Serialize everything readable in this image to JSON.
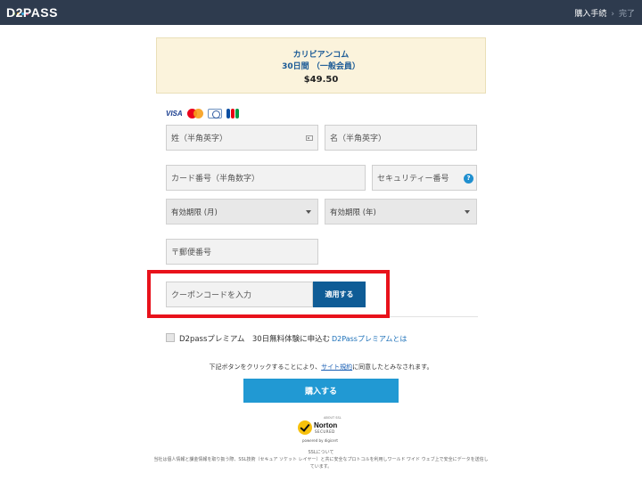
{
  "header": {
    "logo": "D2PASS",
    "steps": [
      {
        "label": "購入手続"
      },
      {
        "label": "完了"
      }
    ],
    "separator": "›"
  },
  "product": {
    "name": "カリビアンコム",
    "plan": "30日間 （一般会員）",
    "price": "$49.50"
  },
  "card_brands": [
    "VISA",
    "mastercard-icon",
    "diners-icon",
    "jcb-icon"
  ],
  "form": {
    "last_name_placeholder": "姓（半角英字）",
    "first_name_placeholder": "名（半角英字）",
    "card_number_placeholder": "カード番号（半角数字）",
    "security_code_placeholder": "セキュリティー番号",
    "help_label": "?",
    "expiry_month": "有効期限 (月)",
    "expiry_year": "有効期限 (年)",
    "postal_placeholder": "〒郵便番号",
    "coupon_placeholder": "クーポンコードを入力",
    "apply_label": "適用する"
  },
  "premium": {
    "text": "D2passプレミアム　30日無料体験に申込む",
    "link": "D2Passプレミアムとは"
  },
  "agreement": {
    "before": "下記ボタンをクリックすることにより、",
    "link": "サイト規約",
    "after": "に同意したとみなされます。"
  },
  "buy_label": "購入する",
  "norton": {
    "top": "ABOUT SSL",
    "word": "Norton",
    "secured": "SECURED",
    "powered": "powered by digicert"
  },
  "ssl": {
    "title": "SSLについて",
    "text": "当社は個人情報と課金情報を取り扱う際、SSL技術（セキュア ソケット レイヤー）と共に安全なプロトコルを利用しワールド ワイド ウェブ上で安全にデータを送信しています。"
  },
  "colors": {
    "header_bg": "#2e3b4e",
    "product_bg": "#fbf3dc",
    "apply_bg": "#0f5c96",
    "buy_bg": "#2199d3",
    "highlight": "#e8121b"
  }
}
